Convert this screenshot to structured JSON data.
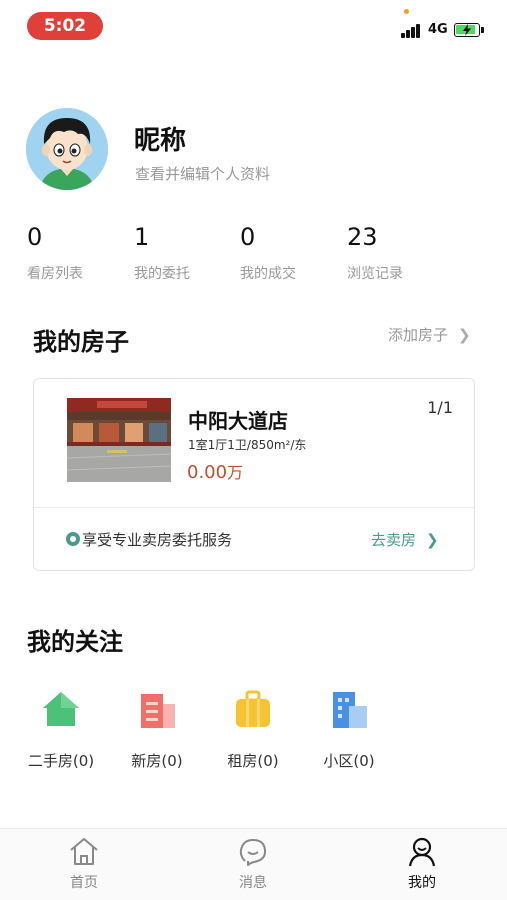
{
  "status_bar": {
    "time": "5:02",
    "network": "4G",
    "time_pill_color": "#e0403a",
    "battery_color": "#4cd964"
  },
  "profile": {
    "nickname": "昵称",
    "edit_hint": "查看并编辑个人资料",
    "avatar_icon": "cartoon-boy-avatar"
  },
  "stats": [
    {
      "value": "0",
      "label": "看房列表"
    },
    {
      "value": "1",
      "label": "我的委托"
    },
    {
      "value": "0",
      "label": "我的成交"
    },
    {
      "value": "23",
      "label": "浏览记录"
    }
  ],
  "my_house": {
    "title": "我的房子",
    "add_label": "添加房子",
    "card": {
      "name": "中阳大道店",
      "counter": "1/1",
      "spec": "1室1厅1卫/850m²/东",
      "price": "0.00",
      "price_unit": "万",
      "price_color": "#c0502f",
      "service_text": "享受专业卖房委托服务",
      "sell_label": "去卖房",
      "accent_color": "#4a9a8e"
    }
  },
  "follow": {
    "title": "我的关注",
    "items": [
      {
        "label": "二手房(0)",
        "icon": "house-icon",
        "color": "#4cc17a"
      },
      {
        "label": "新房(0)",
        "icon": "building-icon",
        "color": "#ef6f6a"
      },
      {
        "label": "租房(0)",
        "icon": "suitcase-icon",
        "color": "#f5c430"
      },
      {
        "label": "小区(0)",
        "icon": "community-icon",
        "color": "#4a90e2"
      }
    ]
  },
  "tab_bar": {
    "tabs": [
      {
        "label": "首页",
        "icon": "home-icon",
        "active": false
      },
      {
        "label": "消息",
        "icon": "message-icon",
        "active": false
      },
      {
        "label": "我的",
        "icon": "profile-icon",
        "active": true
      }
    ]
  }
}
